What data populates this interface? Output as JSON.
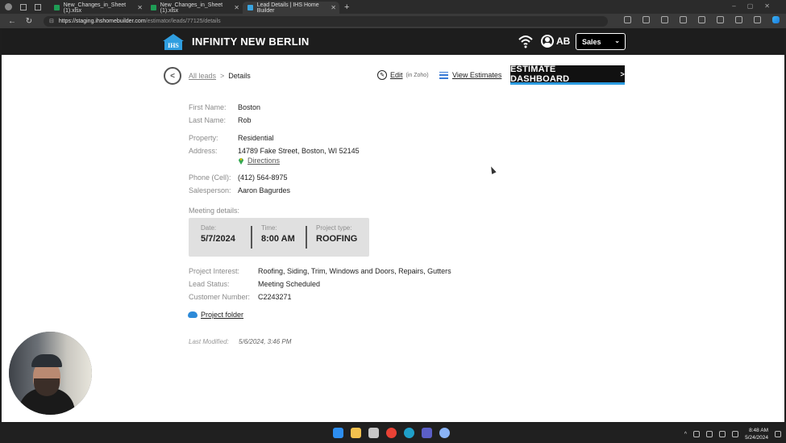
{
  "browser": {
    "tabs": [
      {
        "title": "New_Changes_in_Sheet (1).xlsx",
        "icon": "excel-icon",
        "color": "#1f9d55"
      },
      {
        "title": "New_Changes_in_Sheet (1).xlsx",
        "icon": "excel-icon",
        "color": "#1f9d55"
      },
      {
        "title": "Lead Details | IHS Home Builder",
        "icon": "ihs-icon",
        "color": "#3aa5e0"
      }
    ],
    "url_host": "https://staging.ihshomebuilder.com",
    "url_path": "/estimator/leads/77125/details"
  },
  "header": {
    "logo_text": "IHS",
    "brand": "INFINITY NEW BERLIN",
    "initials": "AB",
    "role": "Sales"
  },
  "nav": {
    "back_icon": "chevron-left-icon",
    "breadcrumb_all": "All leads",
    "breadcrumb_sep": ">",
    "breadcrumb_current": "Details",
    "edit_label": "Edit",
    "edit_note": "(in Zoho)",
    "view_estimates": "View Estimates",
    "dashboard_button": "ESTIMATE DASHBOARD",
    "dashboard_chev": ">"
  },
  "lead": {
    "first_name_label": "First Name:",
    "first_name": "Boston",
    "last_name_label": "Last Name:",
    "last_name": "Rob",
    "property_label": "Property:",
    "property": "Residential",
    "address_label": "Address:",
    "address": "14789 Fake Street, Boston, WI 52145",
    "directions": "Directions",
    "phone_label": "Phone (Cell):",
    "phone": "(412) 564-8975",
    "salesperson_label": "Salesperson:",
    "salesperson": "Aaron Bagurdes"
  },
  "meeting": {
    "section_label": "Meeting details:",
    "date_label": "Date:",
    "date": "5/7/2024",
    "time_label": "Time:",
    "time": "8:00 AM",
    "type_label": "Project type:",
    "type": "ROOFING"
  },
  "project": {
    "interest_label": "Project Interest:",
    "interest": "Roofing, Siding, Trim, Windows and Doors, Repairs, Gutters",
    "status_label": "Lead Status:",
    "status": "Meeting Scheduled",
    "customer_label": "Customer Number:",
    "customer": "C2243271",
    "folder": "Project folder",
    "modified_label": "Last Modified:",
    "modified": "5/6/2024, 3:46 PM"
  },
  "taskbar": {
    "time": "8:48 AM",
    "date": "5/24/2024",
    "apps": [
      "windows-start-icon",
      "file-explorer-icon",
      "calendar-icon",
      "chrome-icon",
      "edge-icon",
      "teams-icon",
      "settings-icon"
    ],
    "app_colors": [
      "#2d8ef0",
      "#f2c14e",
      "#c7c7c7",
      "#e94235",
      "#1fa0c9",
      "#5b5fc7",
      "#8ab4f8"
    ]
  }
}
